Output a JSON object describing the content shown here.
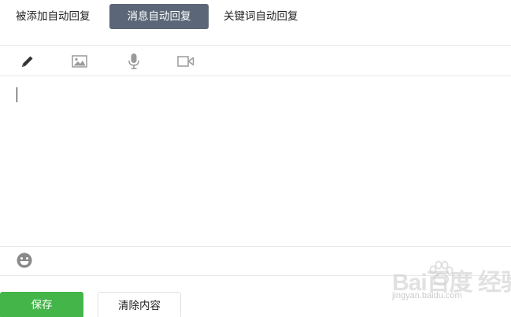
{
  "tabs": [
    {
      "label": "被添加自动回复",
      "active": false
    },
    {
      "label": "消息自动回复",
      "active": true
    },
    {
      "label": "关键词自动回复",
      "active": false
    }
  ],
  "toolbar": {
    "tools": [
      "pencil-icon",
      "image-icon",
      "microphone-icon",
      "video-icon"
    ]
  },
  "editor": {
    "content": ""
  },
  "emoji": {
    "icon": "smiley-icon"
  },
  "buttons": {
    "save_label": "保存",
    "clear_label": "清除内容"
  },
  "watermark": {
    "main": "Bai百度 经验",
    "sub": "jingyan.baidu.com"
  },
  "colors": {
    "active_tab_bg": "#5b6778",
    "save_bg": "#44b549",
    "divider": "#e7e7eb"
  }
}
